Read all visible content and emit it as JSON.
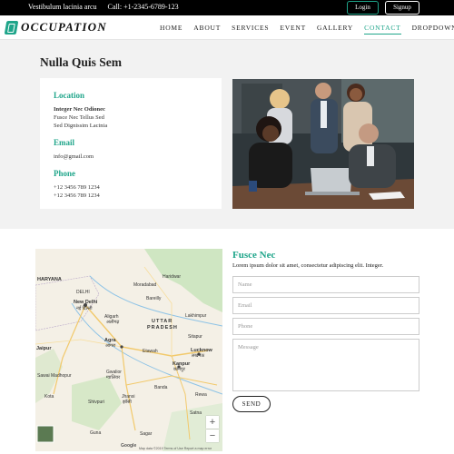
{
  "topbar": {
    "tagline": "Vestibulum lacinia arcu",
    "call": "Call:  +1-2345-6789-123",
    "login_label": "Login",
    "signup_label": "Signup"
  },
  "brand": {
    "name": "OCCUPATION"
  },
  "nav": {
    "items": [
      {
        "label": "HOME"
      },
      {
        "label": "ABOUT"
      },
      {
        "label": "SERVICES"
      },
      {
        "label": "EVENT"
      },
      {
        "label": "GALLERY"
      },
      {
        "label": "CONTACT"
      },
      {
        "label": "DROPDOWN"
      }
    ],
    "active": "CONTACT",
    "dropdown_caret": "▾"
  },
  "contact": {
    "title": "Nulla Quis Sem",
    "location": {
      "heading": "Location",
      "line1": "Integer Nec Odionec",
      "line2": "Fusce Nec Tellus Sed",
      "line3": "Sed Dignissim Lacinia"
    },
    "email": {
      "heading": "Email",
      "value": "info@gmail.com"
    },
    "phone": {
      "heading": "Phone",
      "line1": "+12 3456 789 1234",
      "line2": "+12 3456 789 1234"
    }
  },
  "map": {
    "labels": [
      "HARYANA",
      "DELHI",
      "New Delhi",
      "नई दिल्ली",
      "Aligarh",
      "अलीगढ़",
      "Agra",
      "आगरा",
      "UTTAR",
      "PRADESH",
      "Lucknow",
      "लखनऊ",
      "Kanpur",
      "कानपुर",
      "Gwalior",
      "ग्वालियर",
      "Jhansi",
      "झाँसी",
      "Haridwar",
      "Bareilly",
      "Moradabad",
      "Lakhimpur",
      "Sitapur",
      "Etawah",
      "Jaipur",
      "Sawai Madhopur",
      "Kota",
      "Shivpuri",
      "Guna",
      "Sagar",
      "Banda",
      "Rewa",
      "Satna"
    ],
    "zoom_in": "+",
    "zoom_out": "−",
    "attribution_google": "Google",
    "attribution": "Map data ©2019   Terms of Use   Report a map error"
  },
  "form": {
    "title": "Fusce Nec",
    "subtitle": "Lorem ipsum dolor sit amet, consectetur adipiscing elit. Integer.",
    "name_placeholder": "Name",
    "email_placeholder": "Email",
    "phone_placeholder": "Phone",
    "message_placeholder": "Message",
    "send_label": "SEND"
  },
  "colors": {
    "accent": "#1fa58a",
    "topbar_bg": "#000000",
    "section_bg": "#f2f2f2"
  }
}
